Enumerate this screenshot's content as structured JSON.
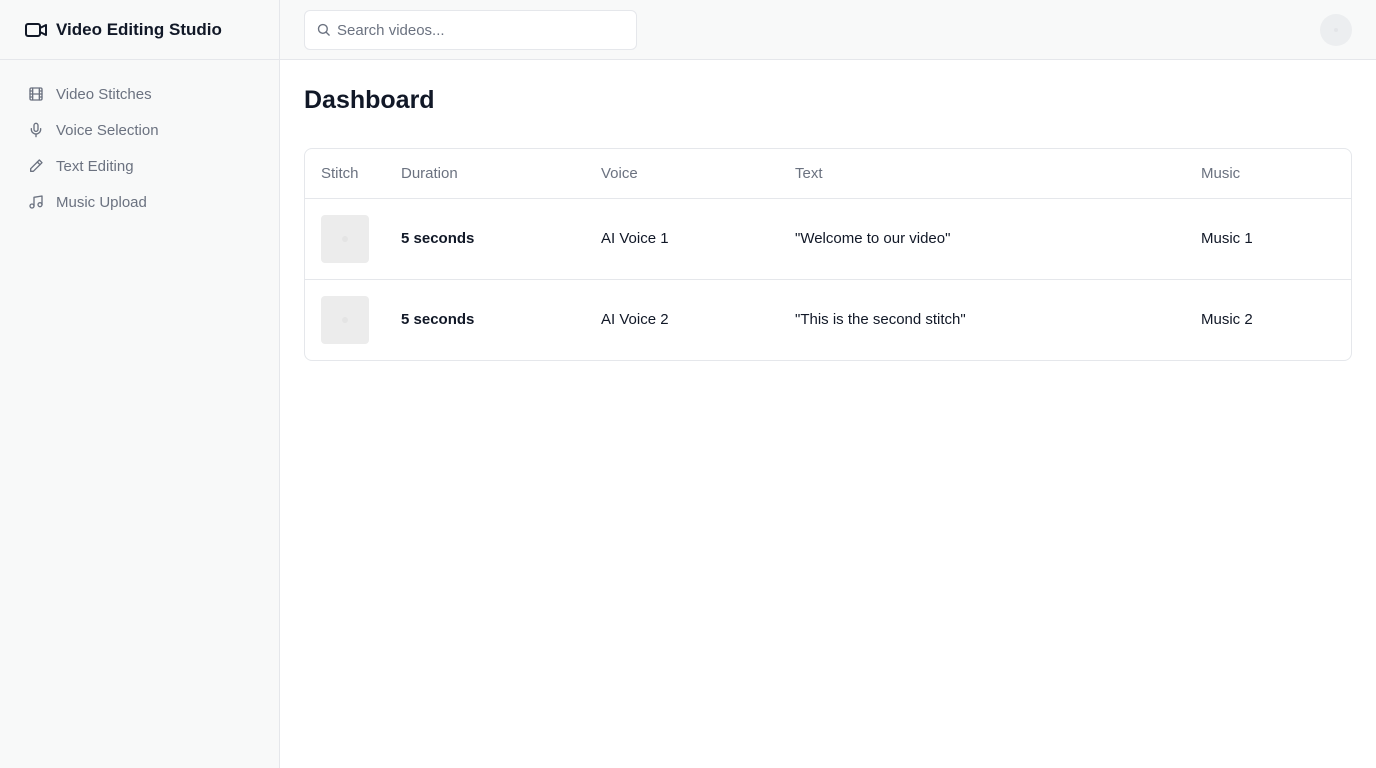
{
  "app": {
    "title": "Video Editing Studio",
    "icon": "video-camera-icon"
  },
  "sidebar": {
    "items": [
      {
        "label": "Video Stitches",
        "icon": "film-icon"
      },
      {
        "label": "Voice Selection",
        "icon": "microphone-icon"
      },
      {
        "label": "Text Editing",
        "icon": "pencil-icon"
      },
      {
        "label": "Music Upload",
        "icon": "music-note-icon"
      }
    ]
  },
  "header": {
    "search_placeholder": "Search videos...",
    "search_value": ""
  },
  "main": {
    "title": "Dashboard",
    "table": {
      "headers": [
        "Stitch",
        "Duration",
        "Voice",
        "Text",
        "Music"
      ],
      "rows": [
        {
          "duration": "5 seconds",
          "voice": "AI Voice 1",
          "text": "\"Welcome to our video\"",
          "music": "Music 1"
        },
        {
          "duration": "5 seconds",
          "voice": "AI Voice 2",
          "text": "\"This is the second stitch\"",
          "music": "Music 2"
        }
      ]
    }
  },
  "colors": {
    "sidebar_bg": "#f8f9f9",
    "border": "#e5e7eb",
    "muted_text": "#6b7280",
    "primary_text": "#111827"
  }
}
